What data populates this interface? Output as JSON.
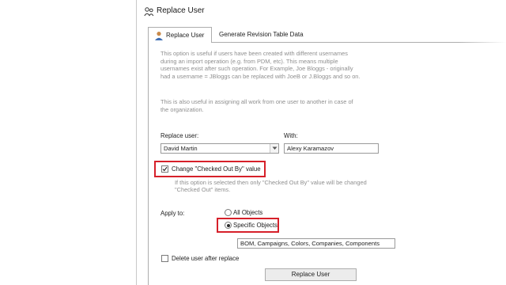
{
  "window": {
    "title": "Replace User"
  },
  "tabs": [
    {
      "label": "Replace User",
      "active": true
    },
    {
      "label": "Generate Revision Table Data",
      "active": false
    }
  ],
  "description": {
    "paragraph1": [
      "This option is useful if users have been created with different usernames",
      "during an import operation (e.g. from PDM, etc). This means multiple",
      "usernames exist after such operation. For Example, Joe Bloggs - originally",
      "had a username = JBloggs can be replaced with JoeB or J.Bloggs and so on."
    ],
    "paragraph2": [
      "This is also useful in assigning all work from one user to another in case of",
      "the organization."
    ]
  },
  "replace_user": {
    "label": "Replace user:",
    "value": "David Martin"
  },
  "with_user": {
    "label": "With:",
    "value": "Alexy Karamazov"
  },
  "checked_out_by": {
    "label": "Change \"Checked Out By\" value",
    "checked": true,
    "hint": [
      "If this option is selected then only \"Checked Out By\" value will be changed",
      "\"Checked Out\" items."
    ]
  },
  "apply_to": {
    "label": "Apply to:",
    "options": [
      {
        "label": "All Objects",
        "selected": false
      },
      {
        "label": "Specific Objects",
        "selected": true
      }
    ],
    "objects_value": "BOM, Campaigns, Colors, Companies, Components"
  },
  "delete_user": {
    "label": "Delete user after replace",
    "checked": false
  },
  "buttons": {
    "replace": "Replace User"
  },
  "colors": {
    "highlight": "#d6202a",
    "muted_text": "#8f8f8f",
    "border": "#adadad"
  }
}
